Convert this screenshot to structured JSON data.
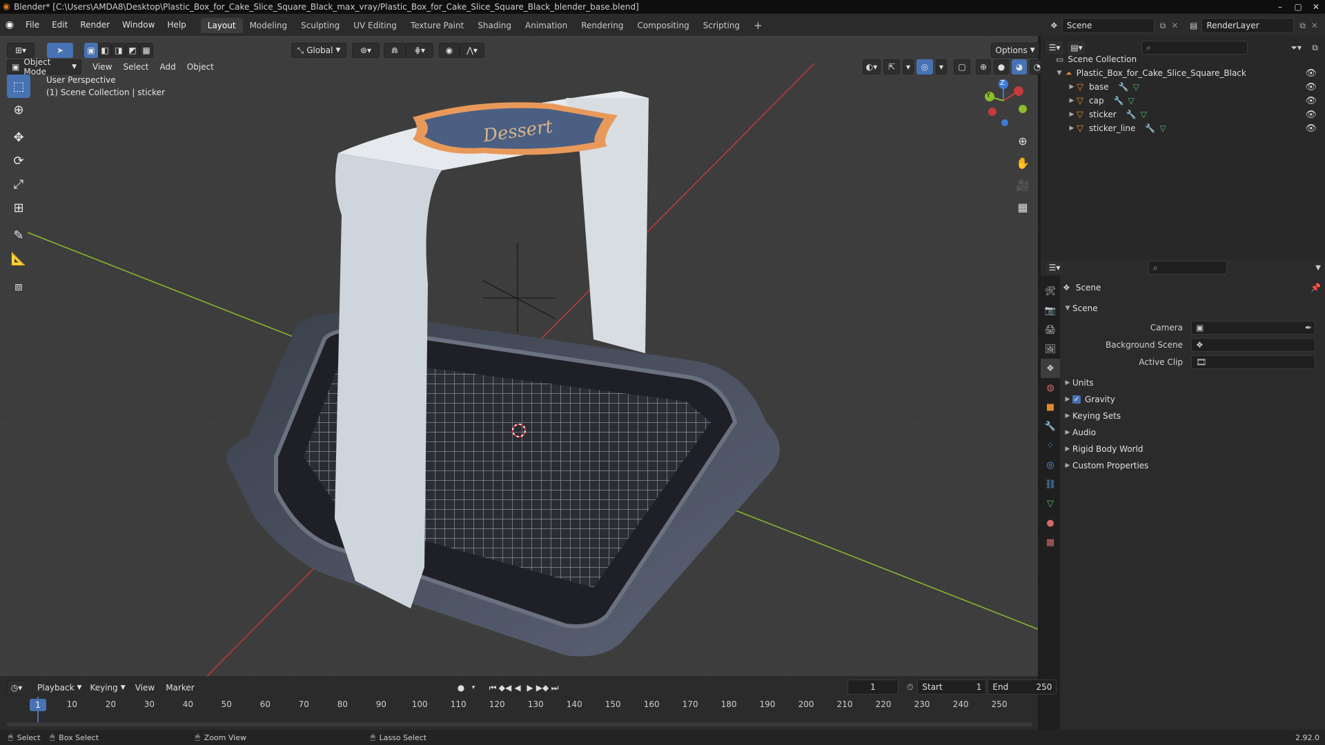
{
  "window": {
    "title": "Blender* [C:\\Users\\AMDA8\\Desktop\\Plastic_Box_for_Cake_Slice_Square_Black_max_vray/Plastic_Box_for_Cake_Slice_Square_Black_blender_base.blend]"
  },
  "menu": [
    "File",
    "Edit",
    "Render",
    "Window",
    "Help"
  ],
  "workspaces": [
    "Layout",
    "Modeling",
    "Sculpting",
    "UV Editing",
    "Texture Paint",
    "Shading",
    "Animation",
    "Rendering",
    "Compositing",
    "Scripting"
  ],
  "top_right": {
    "scene": "Scene",
    "view_layer": "RenderLayer"
  },
  "viewport": {
    "mode": "Object Mode",
    "menus": [
      "View",
      "Select",
      "Add",
      "Object"
    ],
    "orientation": "Global",
    "options": "Options",
    "overlay_title": "User Perspective",
    "overlay_sub": "(1) Scene Collection | sticker",
    "label_text": "Dessert"
  },
  "gizmo": {
    "z": "Z",
    "y": "Y"
  },
  "outliner": {
    "root": "Scene Collection",
    "collection": "Plastic_Box_for_Cake_Slice_Square_Black",
    "objects": [
      "base",
      "cap",
      "sticker",
      "sticker_line"
    ]
  },
  "properties": {
    "header": "Scene",
    "panel": "Scene",
    "fields": [
      {
        "label": "Camera"
      },
      {
        "label": "Background Scene"
      },
      {
        "label": "Active Clip"
      }
    ],
    "subpanels": [
      "Units",
      "Gravity",
      "Keying Sets",
      "Audio",
      "Rigid Body World",
      "Custom Properties"
    ],
    "gravity_checked": true
  },
  "timeline": {
    "menus": [
      "Playback",
      "Keying",
      "View",
      "Marker"
    ],
    "current_frame": "1",
    "start_label": "Start",
    "start": "1",
    "end_label": "End",
    "end": "250",
    "ticks": [
      "1",
      "10",
      "20",
      "30",
      "40",
      "50",
      "60",
      "70",
      "80",
      "90",
      "100",
      "110",
      "120",
      "130",
      "140",
      "150",
      "160",
      "170",
      "180",
      "190",
      "200",
      "210",
      "220",
      "230",
      "240",
      "250"
    ]
  },
  "statusbar": {
    "items": [
      "Select",
      "Box Select",
      "Zoom View",
      "Lasso Select"
    ],
    "version": "2.92.0"
  },
  "colors": {
    "accent": "#4772b3",
    "object_orange": "#e08a2a",
    "mesh_green": "#4fc16d",
    "x_axis": "#c53a3a",
    "y_axis": "#8bbd2c"
  }
}
